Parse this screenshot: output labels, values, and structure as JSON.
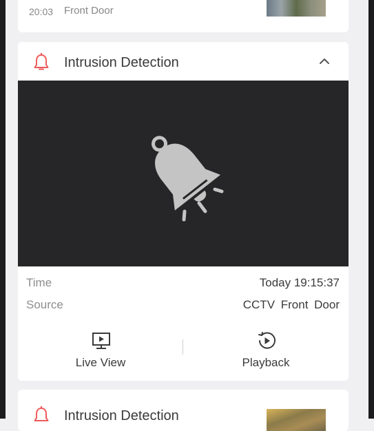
{
  "previous_event": {
    "time": "20:03",
    "source": "Front Door"
  },
  "current_event": {
    "title": "Intrusion Detection",
    "time_label": "Time",
    "time_value": "Today 19:15:37",
    "source_label": "Source",
    "source_value": "CCTV  Front Door",
    "actions": [
      {
        "label": "Live View",
        "icon": "live-view-icon"
      },
      {
        "label": "Playback",
        "icon": "playback-icon"
      }
    ]
  },
  "next_event": {
    "title": "Intrusion Detection"
  },
  "colors": {
    "alarm_accent": "#f05a5a",
    "preview_bg": "#262628",
    "card_bg": "#ffffff",
    "page_bg": "#f0f0f2",
    "icon_gray": "#c4c4c4"
  },
  "icons": {
    "alarm": "bell-icon",
    "collapse": "chevron-up-icon"
  }
}
